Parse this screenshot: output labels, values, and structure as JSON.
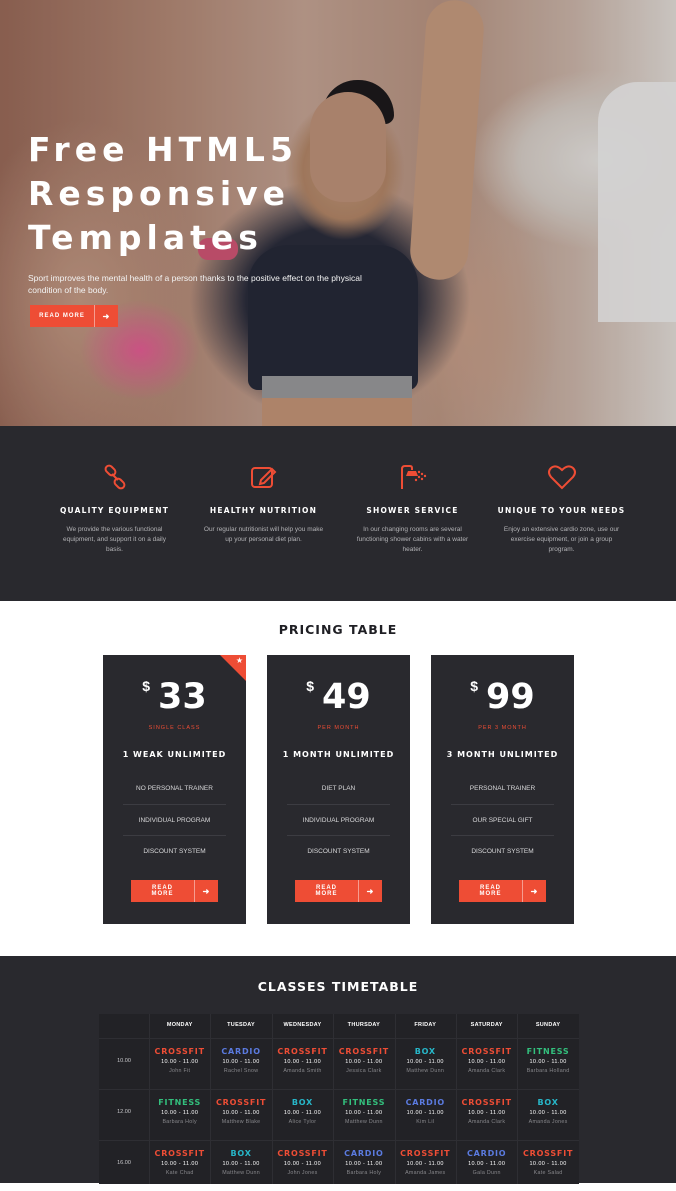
{
  "hero": {
    "title": "Free HTML5 Responsive Templates",
    "text": "Sport improves the mental health of a person thanks to the positive effect on the physical condition of the body.",
    "button_label": "READ MORE",
    "button_icon": "arrow-right-icon"
  },
  "features": [
    {
      "icon": "link-chain-icon",
      "title": "QUALITY EQUIPMENT",
      "text": "We provide the various functional equipment, and support it on a daily basis."
    },
    {
      "icon": "edit-note-icon",
      "title": "HEALTHY NUTRITION",
      "text": "Our regular nutritionist will help you make up your personal diet plan."
    },
    {
      "icon": "shower-icon",
      "title": "SHOWER SERVICE",
      "text": "In our changing rooms are several functioning shower cabins with a water heater."
    },
    {
      "icon": "heart-icon",
      "title": "UNIQUE TO YOUR NEEDS",
      "text": "Enjoy an extensive cardio zone, use our exercise equipment, or join a group program."
    }
  ],
  "pricing": {
    "title": "PRICING TABLE",
    "plans": [
      {
        "currency": "$",
        "amount": "33",
        "period": "SINGLE CLASS",
        "name": "1 WEAK UNLIMITED",
        "featured": true,
        "items": [
          "NO PERSONAL TRAINER",
          "INDIVIDUAL PROGRAM",
          "DISCOUNT SYSTEM"
        ],
        "button_label": "READ MORE"
      },
      {
        "currency": "$",
        "amount": "49",
        "period": "PER MONTH",
        "name": "1 MONTH UNLIMITED",
        "featured": false,
        "items": [
          "DIET PLAN",
          "INDIVIDUAL PROGRAM",
          "DISCOUNT SYSTEM"
        ],
        "button_label": "READ MORE"
      },
      {
        "currency": "$",
        "amount": "99",
        "period": "PER 3 MONTH",
        "name": "3 MONTH UNLIMITED",
        "featured": false,
        "items": [
          "PERSONAL TRAINER",
          "OUR SPECIAL GIFT",
          "DISCOUNT SYSTEM"
        ],
        "button_label": "READ MORE"
      }
    ]
  },
  "timetable": {
    "title": "CLASSES TIMETABLE",
    "days": [
      "MONDAY",
      "TUESDAY",
      "WEDNESDAY",
      "THURSDAY",
      "FRIDAY",
      "SATURDAY",
      "SUNDAY"
    ],
    "class_colors": {
      "CROSSFIT": "#ee4d35",
      "CARDIO": "#5b7be0",
      "FITNESS": "#33c07d",
      "BOX": "#27b7c9"
    },
    "rows": [
      {
        "time": "10.00",
        "cells": [
          {
            "class": "CROSSFIT",
            "hours": "10.00 - 11.00",
            "coach": "John Fit"
          },
          {
            "class": "CARDIO",
            "hours": "10.00 - 11.00",
            "coach": "Rachel Snow"
          },
          {
            "class": "CROSSFIT",
            "hours": "10.00 - 11.00",
            "coach": "Amanda Smith"
          },
          {
            "class": "CROSSFIT",
            "hours": "10.00 - 11.00",
            "coach": "Jessica Clark"
          },
          {
            "class": "BOX",
            "hours": "10.00 - 11.00",
            "coach": "Matthew Dunn"
          },
          {
            "class": "CROSSFIT",
            "hours": "10.00 - 11.00",
            "coach": "Amanda Clark"
          },
          {
            "class": "FITNESS",
            "hours": "10.00 - 11.00",
            "coach": "Barbara Holland"
          }
        ]
      },
      {
        "time": "12.00",
        "cells": [
          {
            "class": "FITNESS",
            "hours": "10.00 - 11.00",
            "coach": "Barbara Holy"
          },
          {
            "class": "CROSSFIT",
            "hours": "10.00 - 11.00",
            "coach": "Matthew Blake"
          },
          {
            "class": "BOX",
            "hours": "10.00 - 11.00",
            "coach": "Alice Tylor"
          },
          {
            "class": "FITNESS",
            "hours": "10.00 - 11.00",
            "coach": "Matthew Dunn"
          },
          {
            "class": "CARDIO",
            "hours": "10.00 - 11.00",
            "coach": "Kim Lil"
          },
          {
            "class": "CROSSFIT",
            "hours": "10.00 - 11.00",
            "coach": "Amanda Clark"
          },
          {
            "class": "BOX",
            "hours": "10.00 - 11.00",
            "coach": "Amanda Jones"
          }
        ]
      },
      {
        "time": "16.00",
        "cells": [
          {
            "class": "CROSSFIT",
            "hours": "10.00 - 11.00",
            "coach": "Kate Chad"
          },
          {
            "class": "BOX",
            "hours": "10.00 - 11.00",
            "coach": "Matthew Dunn"
          },
          {
            "class": "CROSSFIT",
            "hours": "10.00 - 11.00",
            "coach": "John Jones"
          },
          {
            "class": "CARDIO",
            "hours": "10.00 - 11.00",
            "coach": "Barbara Holy"
          },
          {
            "class": "CROSSFIT",
            "hours": "10.00 - 11.00",
            "coach": "Amanda James"
          },
          {
            "class": "CARDIO",
            "hours": "10.00 - 11.00",
            "coach": "Gala Dunn"
          },
          {
            "class": "CROSSFIT",
            "hours": "10.00 - 11.00",
            "coach": "Kate Salad"
          }
        ]
      }
    ]
  }
}
